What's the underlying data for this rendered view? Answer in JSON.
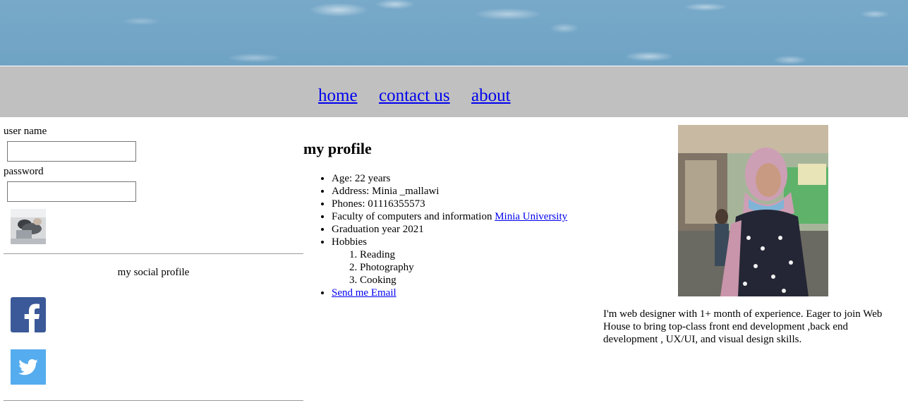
{
  "nav": {
    "home": "home",
    "contact": "contact us",
    "about": "about"
  },
  "login": {
    "username_label": "user name",
    "username_value": "",
    "password_label": "password",
    "password_value": ""
  },
  "social": {
    "title": "my social profile",
    "facebook_icon": "facebook-icon",
    "twitter_icon": "twitter-icon"
  },
  "profile": {
    "title": "my profile",
    "age": "Age: 22 years",
    "address": "Address: Minia _mallawi",
    "phones": "Phones: 01116355573",
    "faculty_text": "Faculty of computers and information ",
    "faculty_link": "Minia University",
    "graduation": "Graduation year 2021",
    "hobbies_label": "Hobbies",
    "hobbies": [
      "Reading",
      "Photography",
      "Cooking"
    ],
    "email_link": "Send me Email"
  },
  "about": {
    "text": "I'm web designer with 1+ month of experience. Eager to join Web House to bring top-class front end development ,back end development , UX/UI, and visual design skills."
  },
  "colors": {
    "link": "#0000ee",
    "navbar": "#c0c0c0",
    "facebook": "#3b5998",
    "twitter": "#55acee"
  }
}
